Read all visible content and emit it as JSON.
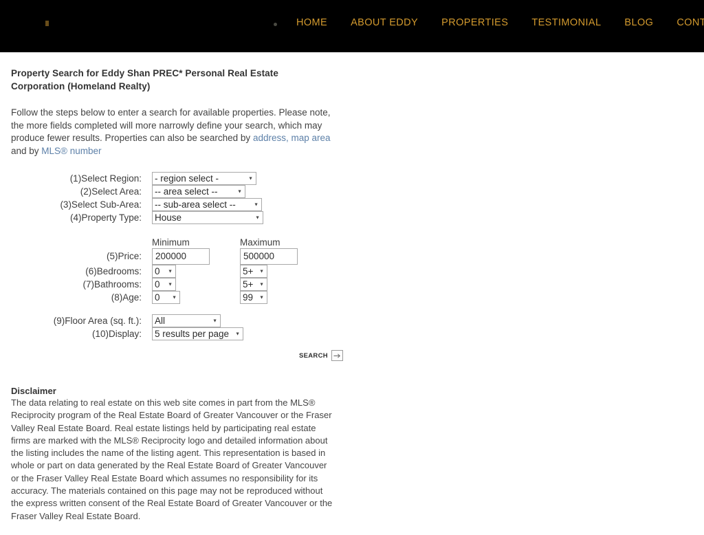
{
  "header": {
    "logo_name": "site-logo",
    "nav": [
      {
        "label": "HOME"
      },
      {
        "label": "ABOUT EDDY"
      },
      {
        "label": "PROPERTIES"
      },
      {
        "label": "TESTIMONIAL"
      },
      {
        "label": "BLOG"
      },
      {
        "label": "CONTACT"
      }
    ],
    "nav_color": "#d39a2e",
    "background": "#000000"
  },
  "main": {
    "title": "Property Search for Eddy Shan PREC* Personal Real Estate Corporation (Homeland Realty)",
    "intro": {
      "part1": "Follow the steps below to enter a search for available properties. Please note, the more fields completed will more narrowly define your search, which may produce fewer results. Properties can also be searched by ",
      "link1": "address, map area",
      "part2": " and by ",
      "link2": "MLS® number",
      "link_color": "#5d80a8"
    },
    "form": {
      "column_headers": {
        "minimum": "Minimum",
        "maximum": "Maximum"
      },
      "rows": {
        "region": {
          "label": "(1)Select Region:",
          "value": "- region select -"
        },
        "area": {
          "label": "(2)Select Area:",
          "value": "-- area select --"
        },
        "subarea": {
          "label": "(3)Select Sub-Area:",
          "value": "-- sub-area select --"
        },
        "property_type": {
          "label": "(4)Property Type:",
          "value": "House"
        },
        "price": {
          "label": "(5)Price:",
          "min": "200000",
          "max": "500000"
        },
        "bedrooms": {
          "label": "(6)Bedrooms:",
          "min": "0",
          "max": "5+"
        },
        "bathrooms": {
          "label": "(7)Bathrooms:",
          "min": "0",
          "max": "5+"
        },
        "age": {
          "label": "(8)Age:",
          "min": "0",
          "max": "99"
        },
        "floor_area": {
          "label": "(9)Floor Area (sq. ft.):",
          "value": "All"
        },
        "display": {
          "label": "(10)Display:",
          "value": "5 results per page"
        }
      },
      "search_button": {
        "label": "SEARCH",
        "icon": "arrow-right-icon"
      }
    },
    "disclaimer": {
      "title": "Disclaimer",
      "body": "The data relating to real estate on this web site comes in part from the MLS® Reciprocity program of the Real Estate Board of Greater Vancouver or the Fraser Valley Real Estate Board. Real estate listings held by participating real estate firms are marked with the MLS® Reciprocity logo and detailed information about the listing includes the name of the listing agent. This representation is based in whole or part on data generated by the Real Estate Board of Greater Vancouver or the Fraser Valley Real Estate Board which assumes no responsibility for its accuracy. The materials contained on this page may not be reproduced without the express written consent of the Real Estate Board of Greater Vancouver or the Fraser Valley Real Estate Board."
    }
  }
}
